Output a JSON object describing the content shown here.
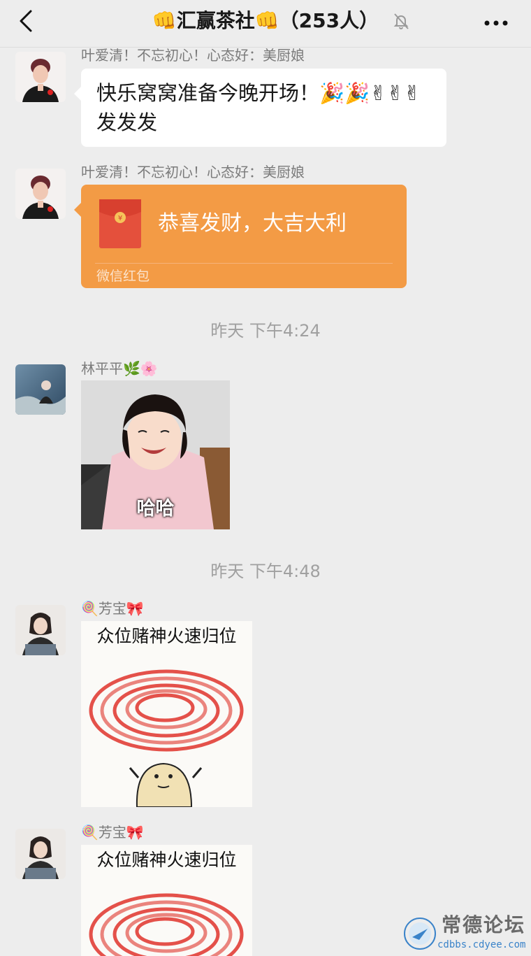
{
  "header": {
    "title": "👊汇赢茶社👊（253人）"
  },
  "messages": [
    {
      "sender": "叶爱清！不忘初心！心态好：美厨娘",
      "text": "快乐窝窝准备今晚开场！🎉🎉✌✌✌发发发"
    },
    {
      "sender": "叶爱清！不忘初心！心态好：美厨娘",
      "red_packet": {
        "title": "恭喜发财，大吉大利",
        "footer": "微信红包"
      }
    },
    {
      "timestamp": "昨天 下午4:24"
    },
    {
      "sender": "林平平🌿🌸",
      "sticker_caption": "哈哈"
    },
    {
      "timestamp": "昨天 下午4:48"
    },
    {
      "sender": "🍭芳宝🎀",
      "sticker_caption": "众位赌神火速归位"
    },
    {
      "sender": "🍭芳宝🎀",
      "sticker_caption": "众位赌神火速归位"
    }
  ],
  "watermark": {
    "name": "常德论坛",
    "url": "cdbbs.cdyee.com"
  },
  "colors": {
    "background": "#ededed",
    "red_packet": "#f39b45",
    "bubble": "#ffffff"
  }
}
